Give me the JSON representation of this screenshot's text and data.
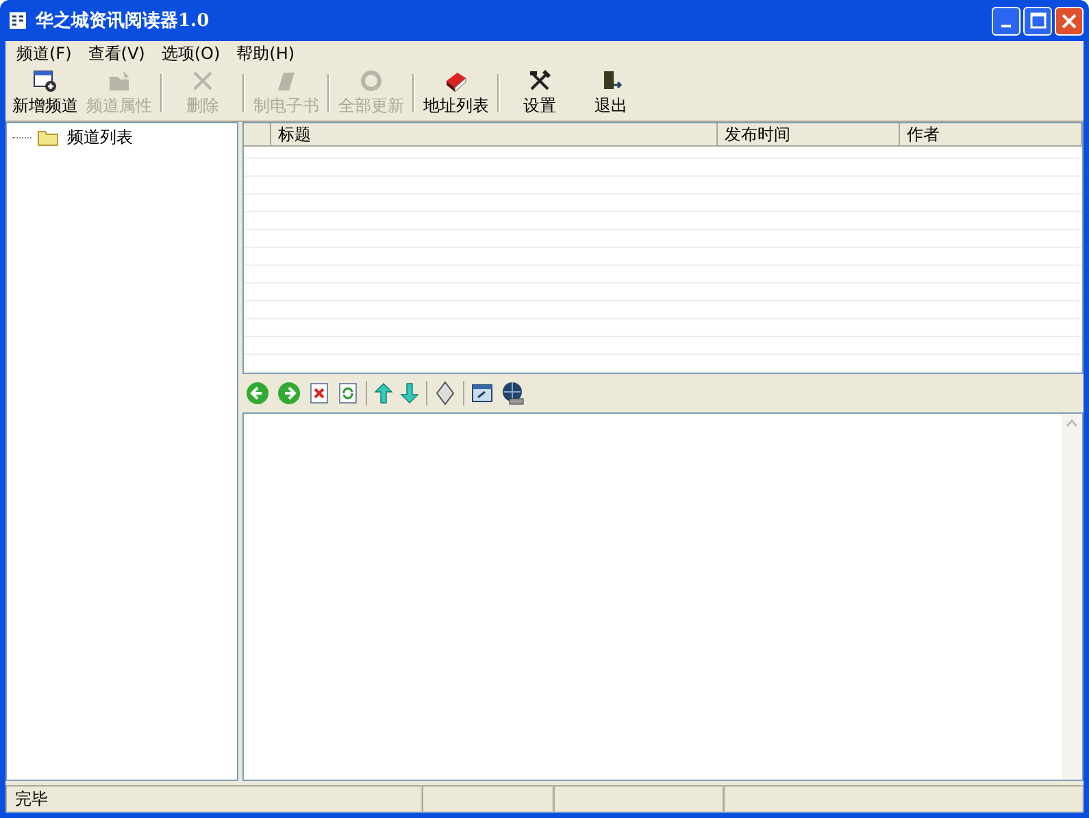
{
  "window": {
    "title": "华之城资讯阅读器1.0"
  },
  "menu": [
    "频道(F)",
    "查看(V)",
    "选项(O)",
    "帮助(H)"
  ],
  "toolbar": [
    {
      "label": "新增频道",
      "disabled": false
    },
    {
      "label": "频道属性",
      "disabled": true
    },
    {
      "label": "删除",
      "disabled": true
    },
    {
      "label": "制电子书",
      "disabled": true
    },
    {
      "label": "全部更新",
      "disabled": true
    },
    {
      "label": "地址列表",
      "disabled": false
    },
    {
      "label": "设置",
      "disabled": false
    },
    {
      "label": "退出",
      "disabled": false
    }
  ],
  "sidebar": {
    "items": [
      {
        "label": "频道列表",
        "selected": false
      }
    ]
  },
  "table": {
    "columns": [
      "标题",
      "发布时间",
      "作者"
    ]
  },
  "status_bar": [
    "完毕"
  ]
}
